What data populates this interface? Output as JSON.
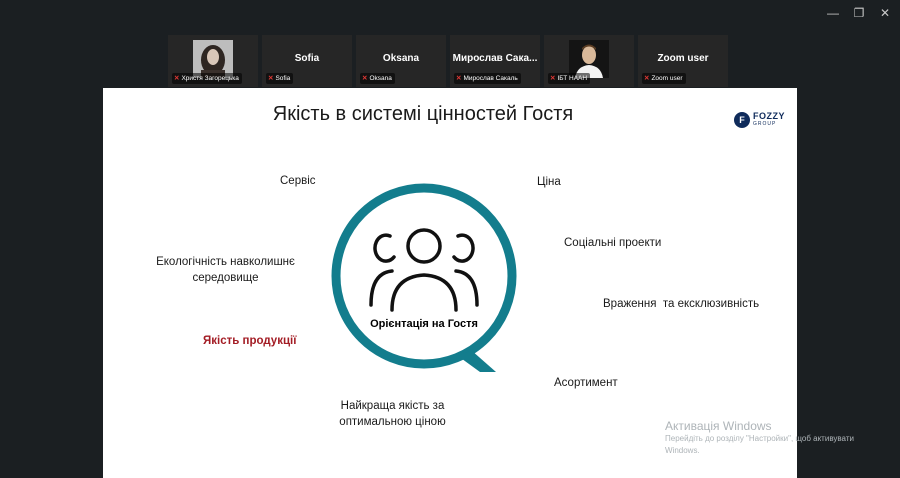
{
  "window": {
    "minimize_glyph": "—",
    "restore_glyph": "❐",
    "close_glyph": "✕"
  },
  "participants": [
    {
      "name": "",
      "tag": "Христя Загорецька"
    },
    {
      "name": "Sofia",
      "tag": "Sofia"
    },
    {
      "name": "Oksana",
      "tag": "Oksana"
    },
    {
      "name": "Мирослав Сака...",
      "tag": "Мирослав Сакаль"
    },
    {
      "name": "",
      "tag": "ІБТ НААН"
    },
    {
      "name": "Zoom user",
      "tag": "Zoom user"
    }
  ],
  "mic_icon": "mic-muted-icon",
  "slide": {
    "title": "Якість в системі цінностей Гостя",
    "logo": {
      "line1": "FOZZY",
      "line2": "GROUP",
      "mark": "F"
    },
    "center_label": "Орієнтація на Гостя",
    "labels": {
      "service": "Сервіс",
      "ecology_1": "Екологічність навколишнє",
      "ecology_2": "середовище",
      "product_quality": "Якість продукції",
      "best_quality_1": "Найкраща якість за",
      "best_quality_2": "оптимальною ціною",
      "price": "Ціна",
      "social": "Соціальні проекти",
      "impressions": "Враження  та ексклюзивність",
      "assortment": "Асортимент"
    },
    "colors": {
      "ring": "#137d8d",
      "highlight": "#a31c24"
    }
  },
  "windows_activation": {
    "title": "Активація Windows",
    "subtitle": "Перейдіть до розділу \"Настройки\", щоб активувати Windows."
  }
}
